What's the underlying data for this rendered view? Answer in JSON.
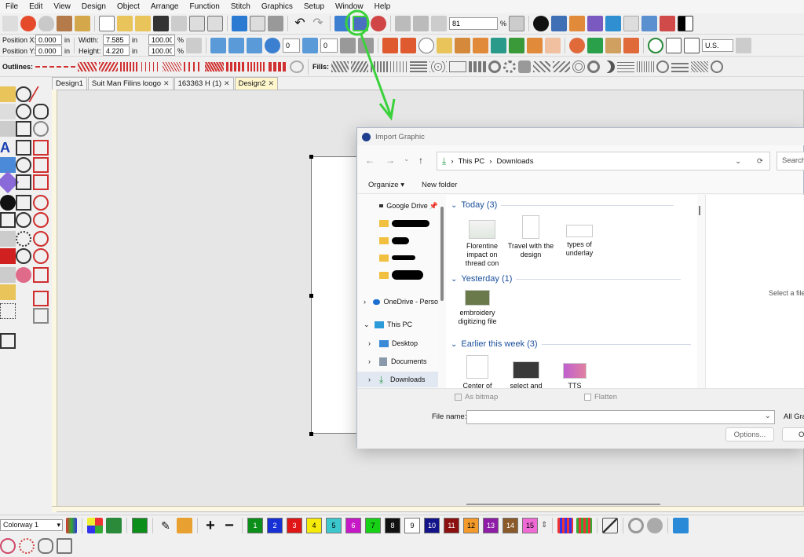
{
  "menu": [
    "File",
    "Edit",
    "View",
    "Design",
    "Object",
    "Arrange",
    "Function",
    "Stitch",
    "Graphics",
    "Setup",
    "Window",
    "Help"
  ],
  "toolbar1": {
    "zoom_value": "81",
    "zoom_unit": "%"
  },
  "position": {
    "x_label": "Position X:",
    "x_value": "0.000",
    "x_unit": "in",
    "y_label": "Position Y:",
    "y_value": "0.000",
    "y_unit": "in",
    "width_label": "Width:",
    "width_value": "7.585",
    "width_unit": "in",
    "width_pct": "100.00",
    "width_pct_unit": "%",
    "height_label": "Height:",
    "height_value": "4.220",
    "height_unit": "in",
    "height_pct": "100.00",
    "height_pct_unit": "%",
    "rotate_value": "0",
    "slant_value": "0",
    "units": "U.S."
  },
  "outlines_label": "Outlines:",
  "fills_label": "Fills:",
  "tabs": [
    {
      "label": "Design1",
      "active": false
    },
    {
      "label": "Suit Man Filins loogo",
      "active": false
    },
    {
      "label": "163363 H (1)",
      "active": false
    },
    {
      "label": "Design2",
      "active": true
    }
  ],
  "dialog": {
    "title": "Import Graphic",
    "breadcrumb": [
      "This PC",
      "Downloads"
    ],
    "search_placeholder": "Search",
    "organize": "Organize",
    "new_folder": "New folder",
    "nav": {
      "google_drive": "Google Drive",
      "onedrive": "OneDrive - Perso",
      "this_pc": "This PC",
      "desktop": "Desktop",
      "documents": "Documents",
      "downloads": "Downloads"
    },
    "groups": {
      "today": "Today (3)",
      "yesterday": "Yesterday (1)",
      "earlier": "Earlier this week (3)"
    },
    "files_today": [
      "Florentine impact on thread con",
      "Travel with the design",
      "types of underlay"
    ],
    "files_yesterday": [
      "embroidery digitizing file"
    ],
    "files_earlier": [
      "Center of",
      "select and",
      "TTS"
    ],
    "preview_text": "Select a file",
    "as_bitmap": "As bitmap",
    "flatten": "Flatten",
    "file_name_label": "File name:",
    "file_type": "All Gra",
    "options_button": "Options...",
    "open_button": "O"
  },
  "colorway": "Colorway 1",
  "swatches": [
    {
      "num": "1",
      "color": "#0b8f1a",
      "text": "#ffffff"
    },
    {
      "num": "2",
      "color": "#1730d6",
      "text": "#ffffff"
    },
    {
      "num": "3",
      "color": "#e01515",
      "text": "#ffffff"
    },
    {
      "num": "4",
      "color": "#f5ea0a",
      "text": "#000000"
    },
    {
      "num": "5",
      "color": "#3cc7cf",
      "text": "#000000"
    },
    {
      "num": "6",
      "color": "#c718c7",
      "text": "#ffffff"
    },
    {
      "num": "7",
      "color": "#17d117",
      "text": "#000000"
    },
    {
      "num": "8",
      "color": "#111111",
      "text": "#ffffff"
    },
    {
      "num": "9",
      "color": "#ffffff",
      "text": "#000000"
    },
    {
      "num": "10",
      "color": "#14148a",
      "text": "#ffffff"
    },
    {
      "num": "11",
      "color": "#8c1010",
      "text": "#ffffff"
    },
    {
      "num": "12",
      "color": "#f49a2a",
      "text": "#000000"
    },
    {
      "num": "13",
      "color": "#8e1ca6",
      "text": "#ffffff"
    },
    {
      "num": "14",
      "color": "#8a5a2a",
      "text": "#ffffff"
    },
    {
      "num": "15",
      "color": "#f06ad6",
      "text": "#000000"
    }
  ],
  "current_color": {
    "num": "1",
    "color": "#0b8f1a"
  }
}
